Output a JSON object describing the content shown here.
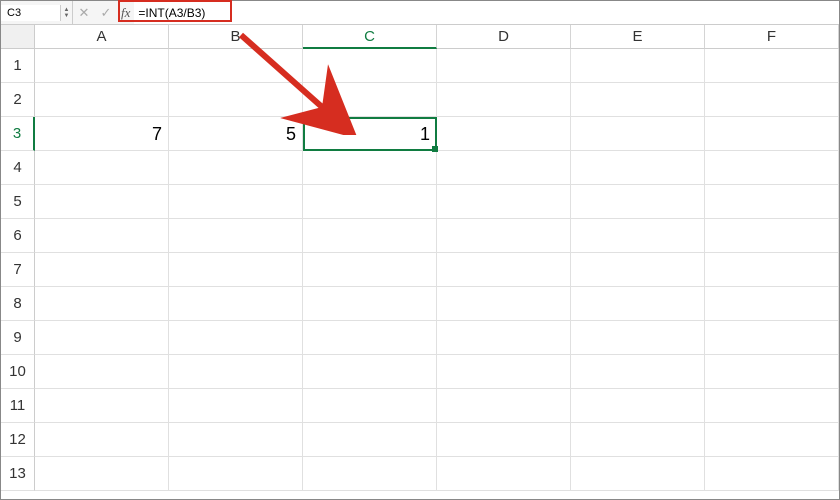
{
  "formulaBar": {
    "nameBox": "C3",
    "fxLabel": "fx",
    "formula": "=INT(A3/B3)",
    "cancelIcon": "✕",
    "confirmIcon": "✓"
  },
  "columns": [
    "A",
    "B",
    "C",
    "D",
    "E",
    "F"
  ],
  "rows": [
    "1",
    "2",
    "3",
    "4",
    "5",
    "6",
    "7",
    "8",
    "9",
    "10",
    "11",
    "12",
    "13"
  ],
  "activeColumn": "C",
  "activeRow": "3",
  "cells": {
    "A3": "7",
    "B3": "5",
    "C3": "1"
  },
  "selection": {
    "col": 2,
    "row": 2
  },
  "annotations": {
    "highlightFormula": true,
    "arrowColor": "#d62d20"
  }
}
